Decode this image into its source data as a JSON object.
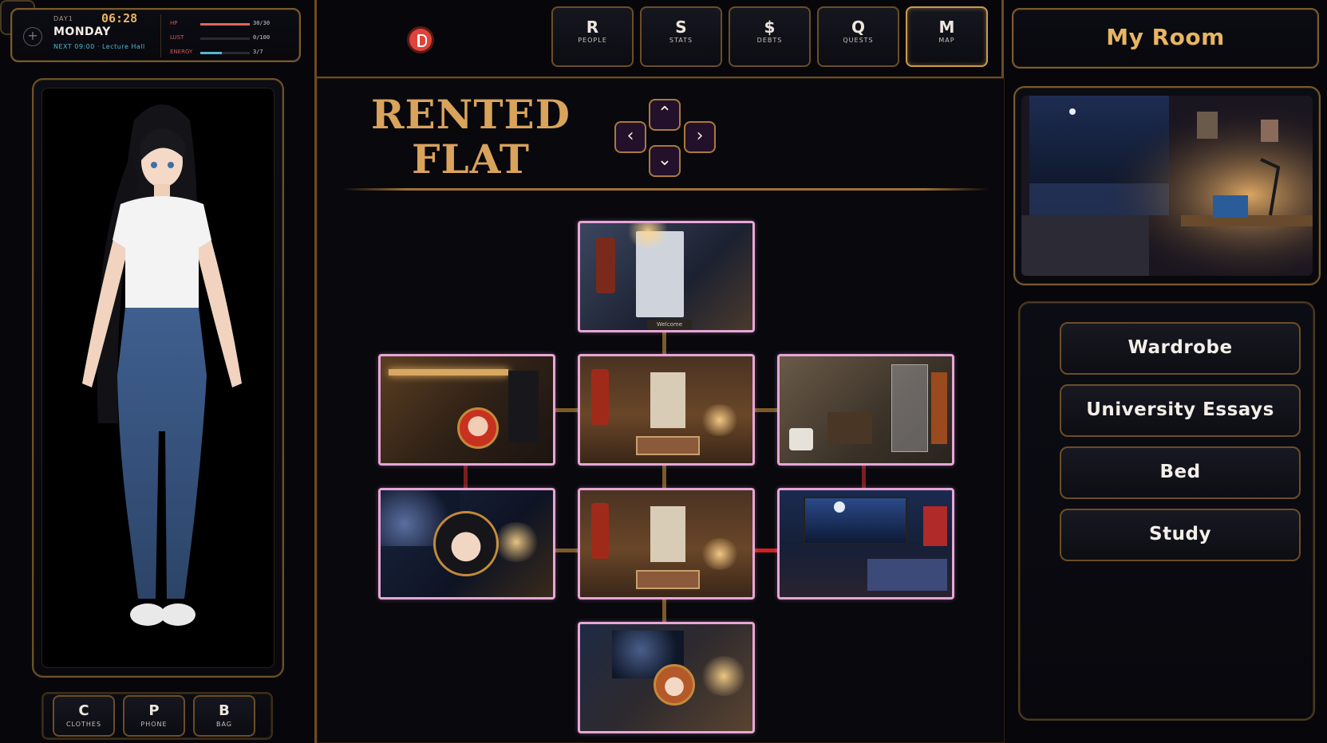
{
  "status": {
    "day_label": "DAY1",
    "clock": "06:28",
    "weekday": "MONDAY",
    "next": "NEXT 09:00 · Lecture Hall",
    "stats": [
      {
        "label": "HP",
        "value_text": "30/30",
        "fraction": 1.0,
        "color": "#e0665a"
      },
      {
        "label": "LUST",
        "value_text": "0/100",
        "fraction": 0.0,
        "color": "#c85a9a"
      },
      {
        "label": "ENERGY",
        "value_text": "3/7",
        "fraction": 0.43,
        "color": "#56b6d6"
      }
    ]
  },
  "nav": [
    {
      "key": "R",
      "label": "PEOPLE",
      "active": false
    },
    {
      "key": "S",
      "label": "STATS",
      "active": false
    },
    {
      "key": "$",
      "label": "DEBTS",
      "active": false
    },
    {
      "key": "Q",
      "label": "QUESTS",
      "active": false
    },
    {
      "key": "M",
      "label": "MAP",
      "active": true
    }
  ],
  "bottom_buttons": [
    {
      "key": "C",
      "label": "CLOTHES"
    },
    {
      "key": "P",
      "label": "PHONE"
    },
    {
      "key": "B",
      "label": "BAG"
    }
  ],
  "music_icon": "♫",
  "map": {
    "title_line1": "RENTED",
    "title_line2": "FLAT",
    "arrows": {
      "up": "⌃",
      "down": "⌄",
      "left": "‹",
      "right": "›"
    },
    "door_mat_text": "Welcome"
  },
  "location": {
    "title": "My Room",
    "actions": [
      "Wardrobe",
      "University Essays",
      "Bed",
      "Study"
    ]
  },
  "colors": {
    "accent_gold": "#e8b562",
    "frame_bronze": "#7a5a2e",
    "room_border": "#e7a6d6",
    "link_red": "#cc2222"
  }
}
